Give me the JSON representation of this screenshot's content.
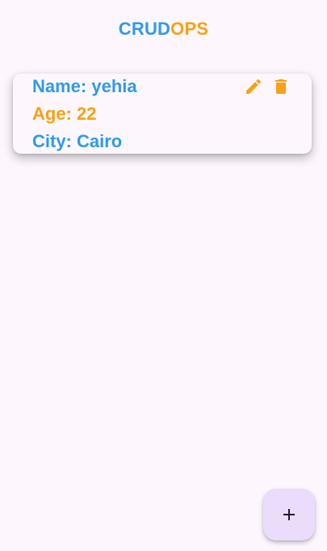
{
  "appbar": {
    "title_part1": "CRUD",
    "title_part2": "OPS"
  },
  "records": [
    {
      "name_text": "Name: yehia",
      "age_text": "Age: 22",
      "city_text": "City: Cairo",
      "actions": {
        "edit_icon": "edit-icon",
        "delete_icon": "delete-icon"
      }
    }
  ],
  "fab": {
    "icon": "add-icon"
  },
  "colors": {
    "blue": "#2f9ae8",
    "orange": "#f7a113",
    "background": "#fdf7fd",
    "fab_background": "#ebdcfb"
  }
}
